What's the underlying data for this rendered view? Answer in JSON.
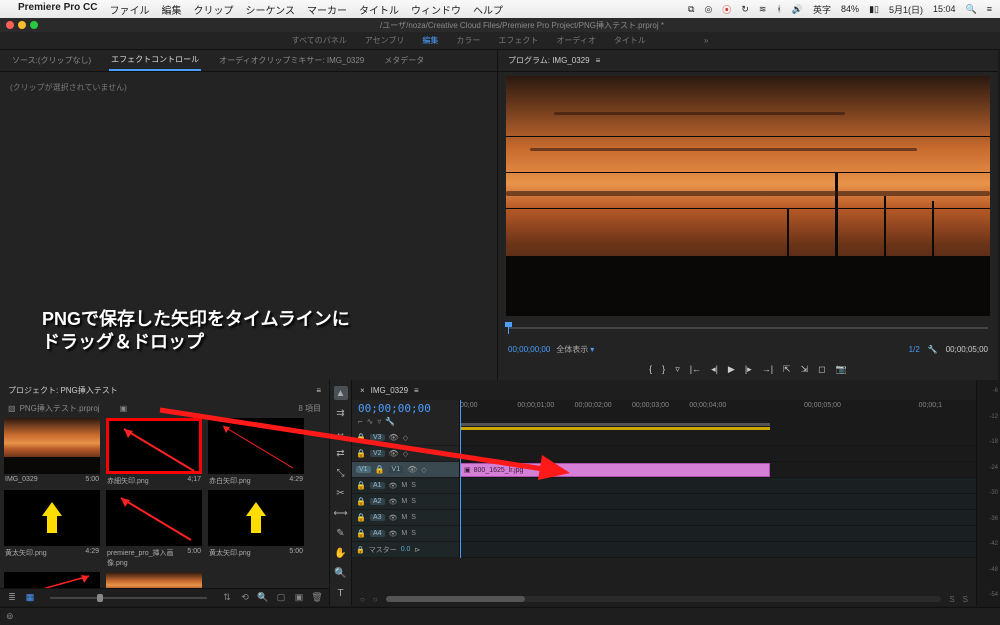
{
  "mac": {
    "app": "Premiere Pro CC",
    "menus": [
      "ファイル",
      "編集",
      "クリップ",
      "シーケンス",
      "マーカー",
      "タイトル",
      "ウィンドウ",
      "ヘルプ"
    ],
    "battery": "84%",
    "ime": "英字",
    "date": "5月1(日)",
    "time": "15:04"
  },
  "titlebar": {
    "path": "/ユーザ/noza/Creative Cloud Files/Premiere Pro Project/PNG挿入テスト.prproj *"
  },
  "workspace": {
    "items": [
      "すべてのパネル",
      "アセンブリ",
      "編集",
      "カラー",
      "エフェクト",
      "オーディオ",
      "タイトル"
    ],
    "active": "編集"
  },
  "source": {
    "tabs": [
      "ソース:(クリップなし)",
      "エフェクトコントロール",
      "オーディオクリップミキサー: IMG_0329",
      "メタデータ"
    ],
    "active": "エフェクトコントロール",
    "empty_msg": "(クリップが選択されていません)"
  },
  "program": {
    "title": "プログラム: IMG_0329",
    "timecode": "00;00;00;00",
    "scale": "全体表示",
    "page": "1/2",
    "duration": "00;00;05;00"
  },
  "project": {
    "title": "プロジェクト: PNG挿入テスト",
    "file": "PNG挿入テスト.prproj",
    "count": "8 項目",
    "bins": [
      {
        "name": "IMG_0329",
        "dur": "5:00",
        "kind": "sunset"
      },
      {
        "name": "赤細矢印.png",
        "dur": "4;17",
        "kind": "red-arrow",
        "selected": true
      },
      {
        "name": "赤白矢印.png",
        "dur": "4:29",
        "kind": "red-arrow-thin"
      },
      {
        "name": "黄太矢印.png",
        "dur": "4:29",
        "kind": "yellow-up"
      },
      {
        "name": "premiere_pro_挿入画像.png",
        "dur": "5:00",
        "kind": "red-arrow-sm"
      },
      {
        "name": "黄太矢印.png",
        "dur": "5:00",
        "kind": "yellow-up"
      },
      {
        "name": "",
        "dur": "",
        "kind": "red-on-dark"
      },
      {
        "name": "",
        "dur": "",
        "kind": "sunset"
      }
    ]
  },
  "timeline": {
    "title": "IMG_0329",
    "timecode": "00;00;00;00",
    "ruler": [
      "00;00",
      "00;00;01;00",
      "00;00;02;00",
      "00;00;03;00",
      "00;00;04;00",
      "",
      "00;00;05;00",
      "",
      "00;00;1"
    ],
    "video_tracks": [
      "V3",
      "V2",
      "V1"
    ],
    "audio_tracks": [
      "A1",
      "A2",
      "A3",
      "A4"
    ],
    "master": "マスター",
    "master_val": "0.0",
    "clip_name": "800_1625_lr.jpg",
    "mute": "M",
    "solo": "S"
  },
  "annotation": {
    "line1": "PNGで保存した矢印をタイムラインに",
    "line2": "ドラッグ＆ドロップ"
  },
  "meter_ticks": [
    "-6",
    "-12",
    "-18",
    "-24",
    "-30",
    "-36",
    "-42",
    "-48",
    "-54"
  ],
  "record_icon": "⦿"
}
